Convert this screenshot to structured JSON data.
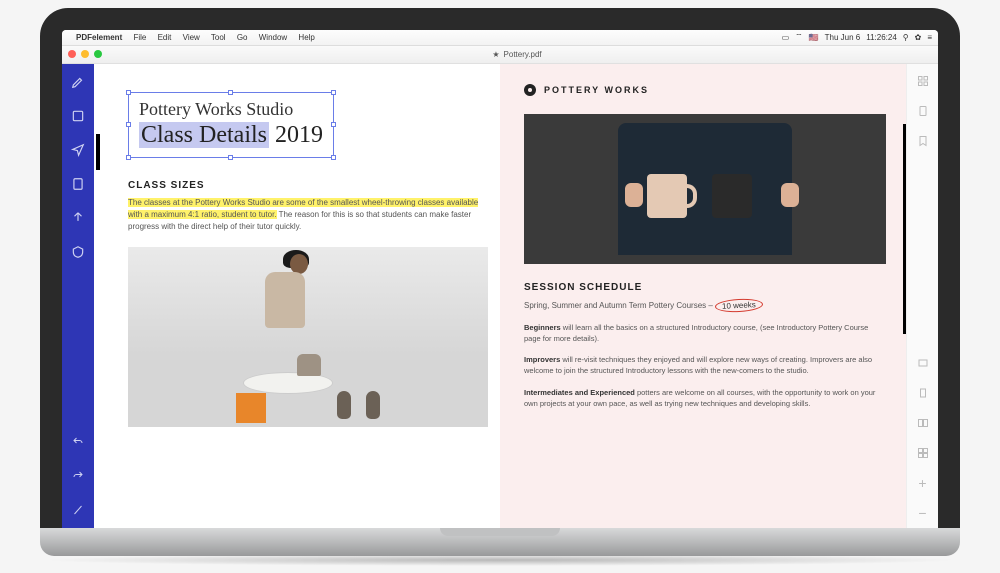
{
  "menubar": {
    "app": "PDFelement",
    "items": [
      "File",
      "Edit",
      "View",
      "Tool",
      "Go",
      "Window",
      "Help"
    ],
    "date": "Thu Jun 6",
    "time": "11:26:24"
  },
  "window": {
    "tab_icon": "★",
    "tab_title": "Pottery.pdf"
  },
  "document": {
    "title_line1": "Pottery Works Studio",
    "title_selected": "Class Details",
    "title_year": "2019",
    "section_class_sizes": "CLASS SIZES",
    "class_sizes_highlight": "The classes at the Pottery Works Studio are some of the smallest wheel-throwing classes available with a maximum 4:1 ratio, student to tutor.",
    "class_sizes_rest": " The reason for this is so that students can make faster progress with the direct help of their tutor quickly.",
    "brand": "POTTERY WORKS",
    "section_schedule": "SESSION SCHEDULE",
    "schedule_intro": "Spring, Summer and Autumn Term Pottery Courses – ",
    "schedule_ring": "10 weeks",
    "para_beginners_b": "Beginners",
    "para_beginners": " will learn all the basics on a structured Introductory course, (see Introductory Pottery Course page for more details).",
    "para_improvers_b": "Improvers",
    "para_improvers": " will re-visit techniques they enjoyed and will explore new ways of creating. Improvers are also welcome to join the structured Introductory lessons with the new-comers to the studio.",
    "para_inter_b": "Intermediates and Experienced",
    "para_inter": " potters are welcome on all courses, with the opportunity to work on your own projects at your own pace, as well as trying new techniques and developing skills."
  }
}
